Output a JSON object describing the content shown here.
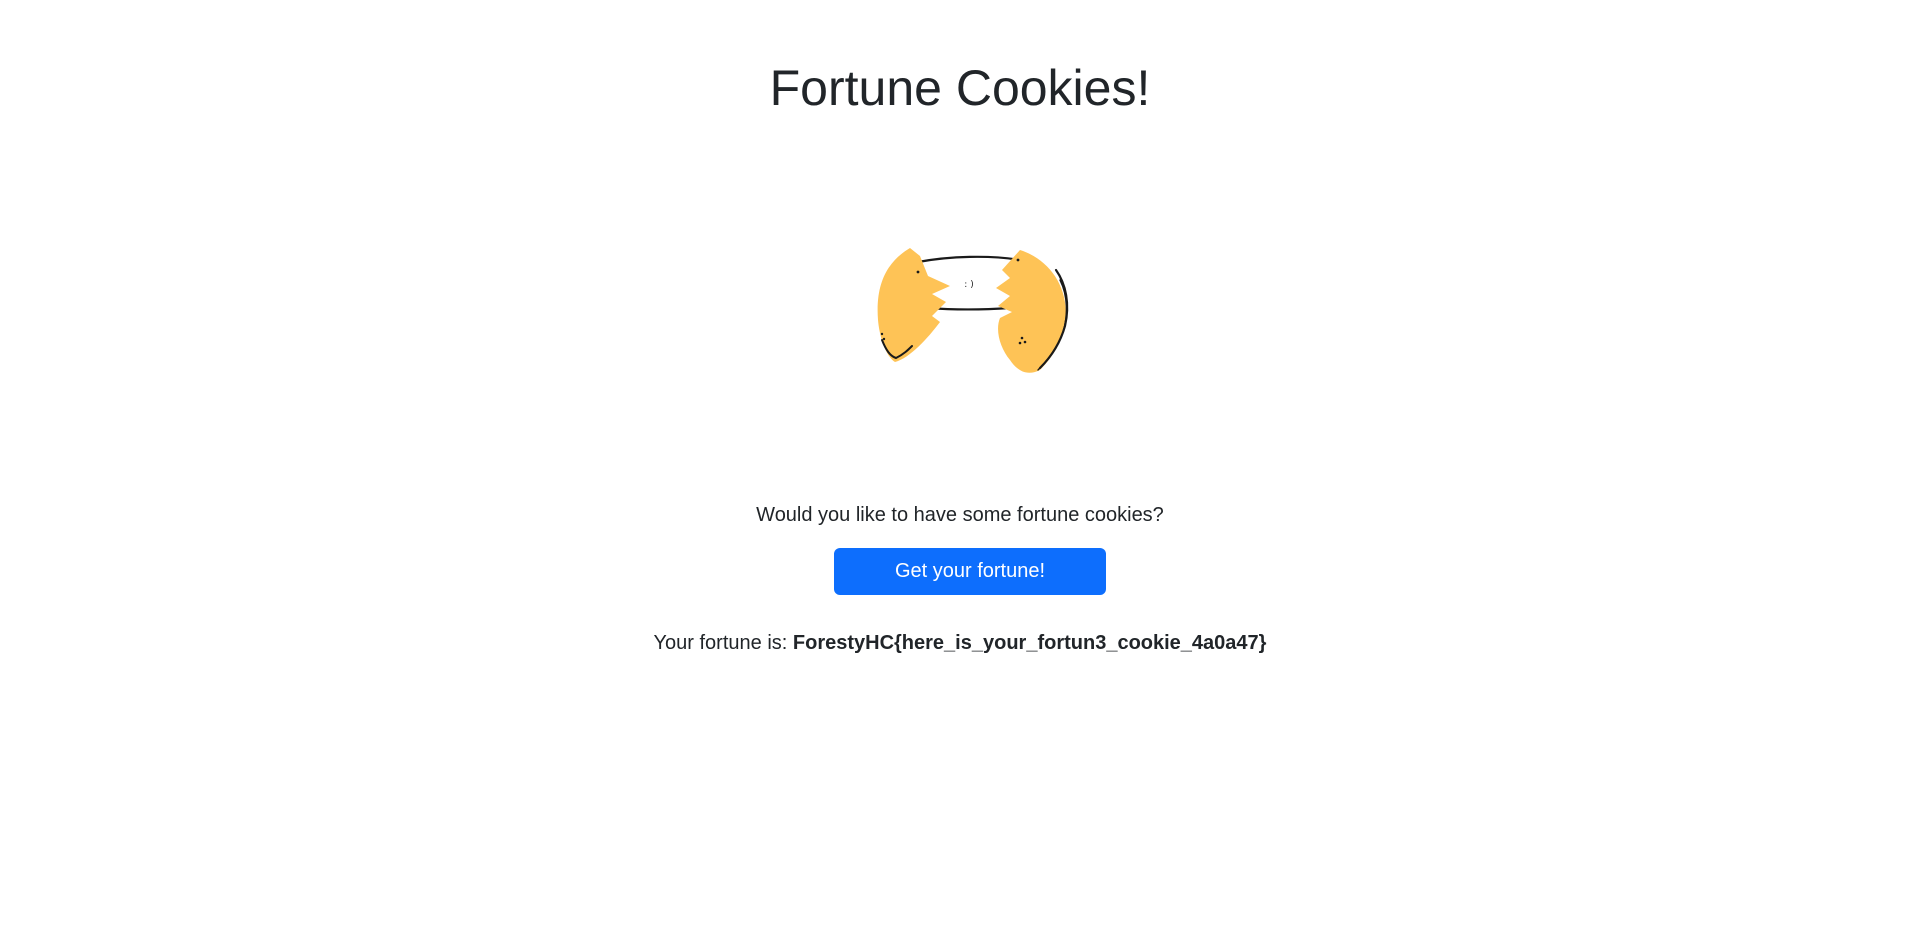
{
  "page": {
    "title": "Fortune Cookies!",
    "illustration": {
      "icon": "fortune-cookie-icon",
      "paper_text": ": )",
      "cookie_color": "#fec356"
    },
    "question": "Would you like to have some fortune cookies?",
    "button_label": "Get your fortune!",
    "result_prefix": "Your fortune is:",
    "result_value": "ForestyHC{here_is_your_fortun3_cookie_4a0a47}",
    "accent_color": "#0d6efd"
  }
}
